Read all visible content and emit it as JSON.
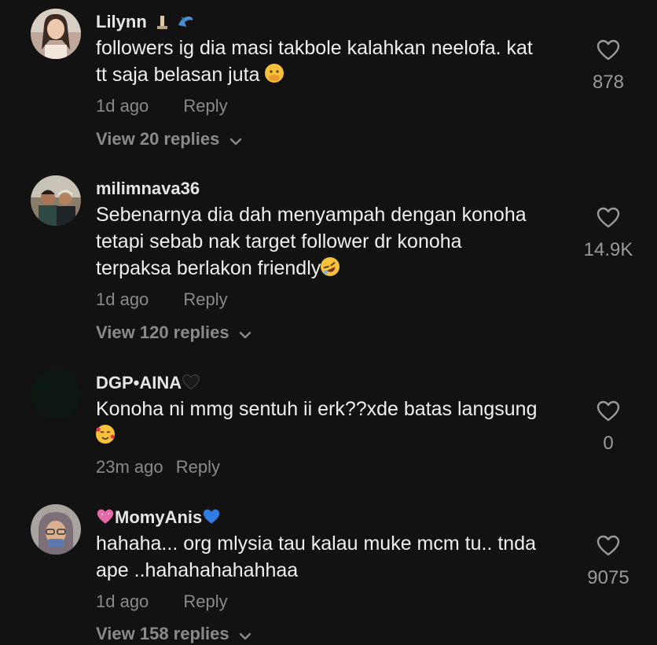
{
  "comments": [
    {
      "username": "Lilynn",
      "username_icons": [
        "tower-icon",
        "dolphin-icon"
      ],
      "lines": [
        "followers ig dia masi takbole kalahkan neelofa. kat",
        "tt saja belasan juta"
      ],
      "line_end_emoji": "face-hand-over-mouth-emoji",
      "time": "1d ago",
      "reply_label": "Reply",
      "view_replies": "View 20 replies",
      "likes": "878"
    },
    {
      "username": "milimnava36",
      "lines": [
        "Sebenarnya dia dah menyampah dengan konoha",
        "tetapi sebab nak target follower dr konoha",
        "terpaksa berlakon friendly"
      ],
      "line_end_emoji": "rolling-on-floor-laughing-emoji",
      "time": "1d ago",
      "reply_label": "Reply",
      "view_replies": "View 120 replies",
      "likes": "14.9K"
    },
    {
      "username": "DGP•AINA",
      "username_suffix_icon": "black-heart-icon",
      "lines": [
        "Konoha ni mmg sentuh ii erk??xde batas langsung"
      ],
      "second_line_emoji": "smiling-face-with-hearts-emoji",
      "time": "23m ago",
      "reply_label": "Reply",
      "likes": "0"
    },
    {
      "username": "MomyAnis",
      "username_prefix_icon": "sparkling-heart-icon",
      "username_suffix_icon": "blue-heart-icon",
      "lines": [
        "hahaha... org mlysia tau kalau muke mcm tu.. tnda",
        "ape ..hahahahahahhaa"
      ],
      "time": "1d ago",
      "reply_label": "Reply",
      "view_replies": "View 158 replies",
      "likes": "9075"
    }
  ],
  "colors": {
    "background": "#121212",
    "text": "#efefef",
    "muted": "#8a8a8a"
  }
}
